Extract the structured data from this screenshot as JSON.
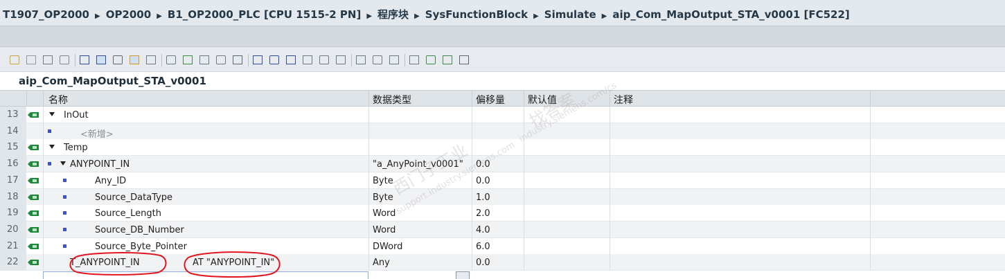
{
  "breadcrumb": [
    "T1907_OP2000",
    "OP2000",
    "B1_OP2000_PLC [CPU 1515-2 PN]",
    "程序块",
    "SysFunctionBlock",
    "Simulate",
    "aip_Com_MapOutput_STA_v0001 [FC522]"
  ],
  "breadcrumb_separator": "▶",
  "toolbar_icons": [
    "insert-row-icon",
    "add-row-icon",
    "export-icon",
    "clear-icon",
    "indent-list-icon",
    "view-toggle-icon",
    "monitor-icon",
    "snapshot-icon",
    "refresh-icon",
    "compare-icon",
    "download-icon",
    "copy-icon",
    "list-icon",
    "filter-icon",
    "align-left-icon",
    "align-center-icon",
    "align-right-icon",
    "grid-icon",
    "sort-icon",
    "expand-icon",
    "pin-icon",
    "goto-icon",
    "back-icon",
    "user-icon",
    "network-icon",
    "network2-icon",
    "breakpoint-icon"
  ],
  "block_name": "aip_Com_MapOutput_STA_v0001",
  "columns": {
    "name": "名称",
    "datatype": "数据类型",
    "offset": "偏移量",
    "default": "默认值",
    "comment": "注释"
  },
  "rows": [
    {
      "num": "13",
      "name": "InOut",
      "type": "",
      "offset": "",
      "indent": 0,
      "expand": true,
      "bullet": false,
      "icon": true,
      "placeholder": false
    },
    {
      "num": "14",
      "name": "<新增>",
      "type": "",
      "offset": "",
      "indent": 1,
      "expand": false,
      "bullet": true,
      "icon": false,
      "placeholder": true
    },
    {
      "num": "15",
      "name": "Temp",
      "type": "",
      "offset": "",
      "indent": 0,
      "expand": true,
      "bullet": false,
      "icon": true,
      "placeholder": false
    },
    {
      "num": "16",
      "name": "ANYPOINT_IN",
      "type": "\"a_AnyPoint_v0001\"",
      "offset": "0.0",
      "indent": 1,
      "expand": true,
      "bullet": true,
      "icon": true,
      "placeholder": false
    },
    {
      "num": "17",
      "name": "Any_ID",
      "type": "Byte",
      "offset": "0.0",
      "indent": 2,
      "expand": false,
      "bullet": true,
      "icon": true,
      "placeholder": false
    },
    {
      "num": "18",
      "name": "Source_DataType",
      "type": "Byte",
      "offset": "1.0",
      "indent": 2,
      "expand": false,
      "bullet": true,
      "icon": true,
      "placeholder": false
    },
    {
      "num": "19",
      "name": "Source_Length",
      "type": "Word",
      "offset": "2.0",
      "indent": 2,
      "expand": false,
      "bullet": true,
      "icon": true,
      "placeholder": false
    },
    {
      "num": "20",
      "name": "Source_DB_Number",
      "type": "Word",
      "offset": "4.0",
      "indent": 2,
      "expand": false,
      "bullet": true,
      "icon": true,
      "placeholder": false
    },
    {
      "num": "21",
      "name": "Source_Byte_Pointer",
      "type": "DWord",
      "offset": "6.0",
      "indent": 2,
      "expand": false,
      "bullet": true,
      "icon": true,
      "placeholder": false
    },
    {
      "num": "22",
      "name": "T_ANYPOINT_IN",
      "at_text": "AT \"ANYPOINT_IN\"",
      "type": "Any",
      "offset": "0.0",
      "indent": 1,
      "expand": false,
      "bullet": false,
      "icon": true,
      "placeholder": false
    }
  ],
  "watermark": {
    "text1": "西门子工业",
    "text2": "support.industry.siemens.com",
    "text3": "找答案",
    "text4": "industry.siemens.com/cs"
  },
  "colors": {
    "accent": "#3a52c4",
    "annotation": "#e0151d",
    "header_bg": "#dfe4e9"
  }
}
